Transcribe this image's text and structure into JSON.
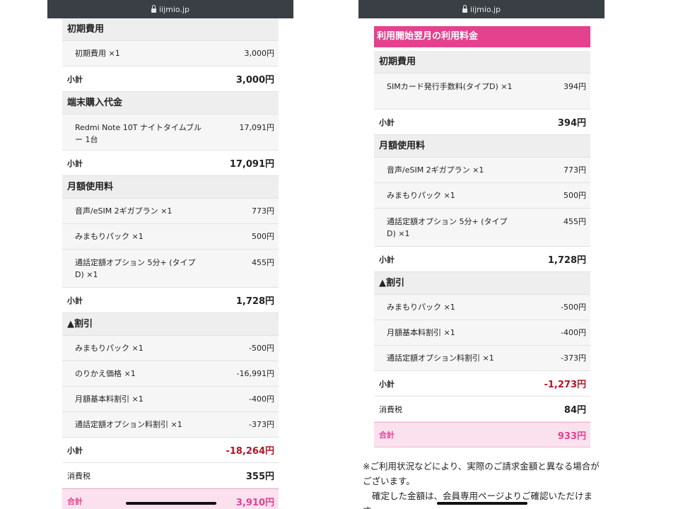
{
  "left": {
    "url": "iijmio.jp",
    "sections": [
      {
        "header": "初期費用",
        "items": [
          {
            "label": "初期費用 ×1",
            "value": "3,000円"
          }
        ],
        "subtotal": {
          "label": "小計",
          "value": "3,000円"
        }
      },
      {
        "header": "端末購入代金",
        "items": [
          {
            "label": "Redmi Note 10T ナイトタイムブルー 1台",
            "value": "17,091円"
          }
        ],
        "subtotal": {
          "label": "小計",
          "value": "17,091円"
        }
      },
      {
        "header": "月額使用料",
        "items": [
          {
            "label": "音声/eSIM 2ギガプラン ×1",
            "value": "773円"
          },
          {
            "label": "みまもりパック ×1",
            "value": "500円"
          },
          {
            "label": "通話定額オプション 5分+ (タイプD) ×1",
            "value": "455円"
          }
        ],
        "subtotal": {
          "label": "小計",
          "value": "1,728円"
        }
      },
      {
        "header": "▲割引",
        "items": [
          {
            "label": "みまもりパック ×1",
            "value": "-500円"
          },
          {
            "label": "のりかえ価格 ×1",
            "value": "-16,991円"
          },
          {
            "label": "月額基本料割引 ×1",
            "value": "-400円"
          },
          {
            "label": "通話定額オプション料割引 ×1",
            "value": "-373円"
          }
        ],
        "subtotal": {
          "label": "小計",
          "value": "-18,264円"
        }
      }
    ],
    "tax": {
      "label": "消費税",
      "value": "355円"
    },
    "total": {
      "label": "合計",
      "value": "3,910円"
    }
  },
  "right": {
    "url": "iijmio.jp",
    "banner": "利用開始翌月の利用料金",
    "sections": [
      {
        "header": "初期費用",
        "items": [
          {
            "label": "SIMカード発行手数料(タイプD) ×1",
            "value": "394円"
          }
        ],
        "subtotal": {
          "label": "小計",
          "value": "394円"
        }
      },
      {
        "header": "月額使用料",
        "items": [
          {
            "label": "音声/eSIM 2ギガプラン ×1",
            "value": "773円"
          },
          {
            "label": "みまもりパック ×1",
            "value": "500円"
          },
          {
            "label": "通話定額オプション 5分+ (タイプD) ×1",
            "value": "455円"
          }
        ],
        "subtotal": {
          "label": "小計",
          "value": "1,728円"
        }
      },
      {
        "header": "▲割引",
        "items": [
          {
            "label": "みまもりパック ×1",
            "value": "-500円"
          },
          {
            "label": "月額基本料割引 ×1",
            "value": "-400円"
          },
          {
            "label": "通話定額オプション料割引 ×1",
            "value": "-373円"
          }
        ],
        "subtotal": {
          "label": "小計",
          "value": "-1,273円"
        }
      }
    ],
    "tax": {
      "label": "消費税",
      "value": "84円"
    },
    "total": {
      "label": "合計",
      "value": "933円"
    },
    "notes": [
      "※ご利用状況などにより、実際のご請求金額と異なる場合がございます。",
      "確定した金額は、会員専用ページよりご確認いただけます。"
    ]
  }
}
